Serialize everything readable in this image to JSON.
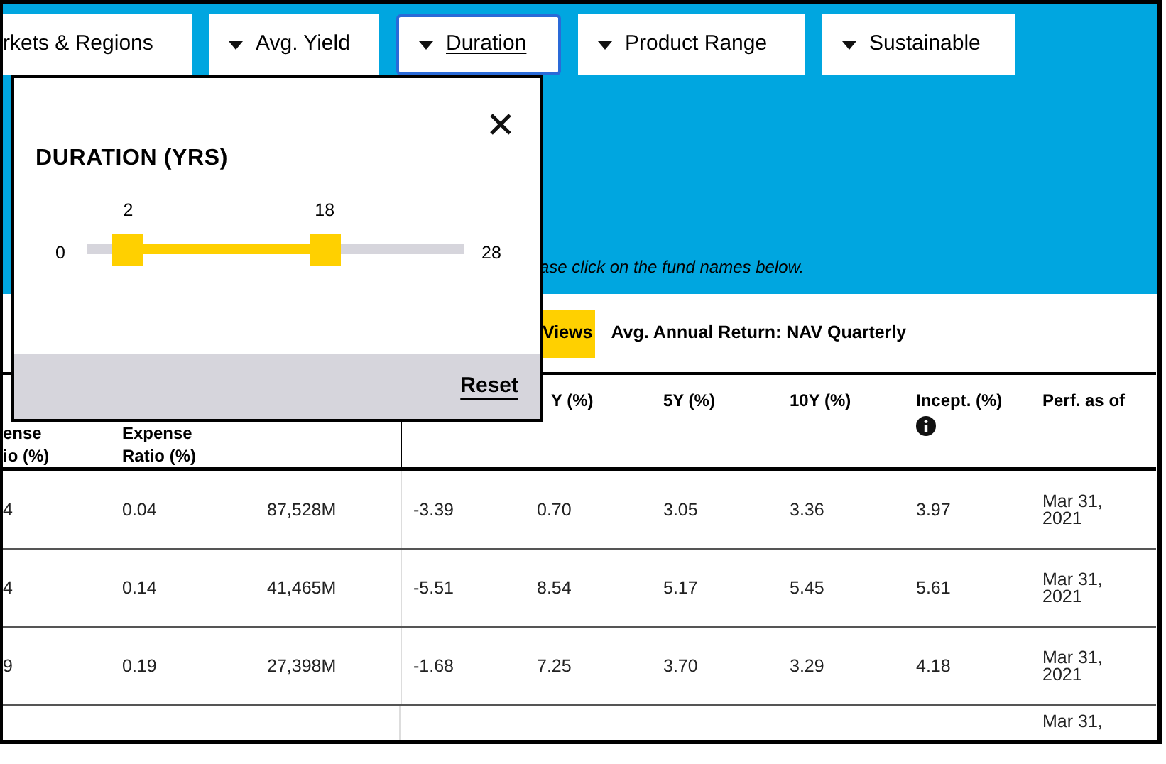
{
  "filters": [
    {
      "label": "rkets & Regions",
      "selected": false,
      "caret": false
    },
    {
      "label": "Avg. Yield",
      "selected": false,
      "caret": true
    },
    {
      "label": "Duration",
      "selected": true,
      "caret": true
    },
    {
      "label": "Product Range",
      "selected": false,
      "caret": true
    },
    {
      "label": "Sustainable",
      "selected": false,
      "caret": true
    }
  ],
  "note": "ase click on the fund names below.",
  "views_button": "Views",
  "return_label": "Avg. Annual Return: NAV Quarterly",
  "table": {
    "columns": [
      {
        "label": "ense io (%)"
      },
      {
        "label": "Expense Ratio (%)"
      },
      {},
      {},
      {
        "label": "Y (%)"
      },
      {
        "label": "5Y (%)"
      },
      {
        "label": "10Y (%)"
      },
      {
        "label": "Incept. (%)",
        "info_icon": true
      },
      {
        "label": "Perf. as of"
      }
    ],
    "rows": [
      {
        "cells": [
          "4",
          "0.04",
          "87,528M",
          "-3.39",
          "0.70",
          "3.05",
          "3.36",
          "3.97",
          "Mar 31, 2021"
        ]
      },
      {
        "cells": [
          "4",
          "0.14",
          "41,465M",
          "-5.51",
          "8.54",
          "5.17",
          "5.45",
          "5.61",
          "Mar 31, 2021"
        ]
      },
      {
        "cells": [
          "9",
          "0.19",
          "27,398M",
          "-1.68",
          "7.25",
          "3.70",
          "3.29",
          "4.18",
          "Mar 31, 2021"
        ]
      }
    ],
    "cut_row": {
      "perf_as_of": "Mar 31,"
    }
  },
  "duration_popover": {
    "title": "DURATION (YRS)",
    "min": "0",
    "max": "28",
    "handles": [
      {
        "label": "2",
        "level": 0.11
      },
      {
        "label": "18",
        "level": 0.63
      }
    ],
    "reset": "Reset"
  }
}
